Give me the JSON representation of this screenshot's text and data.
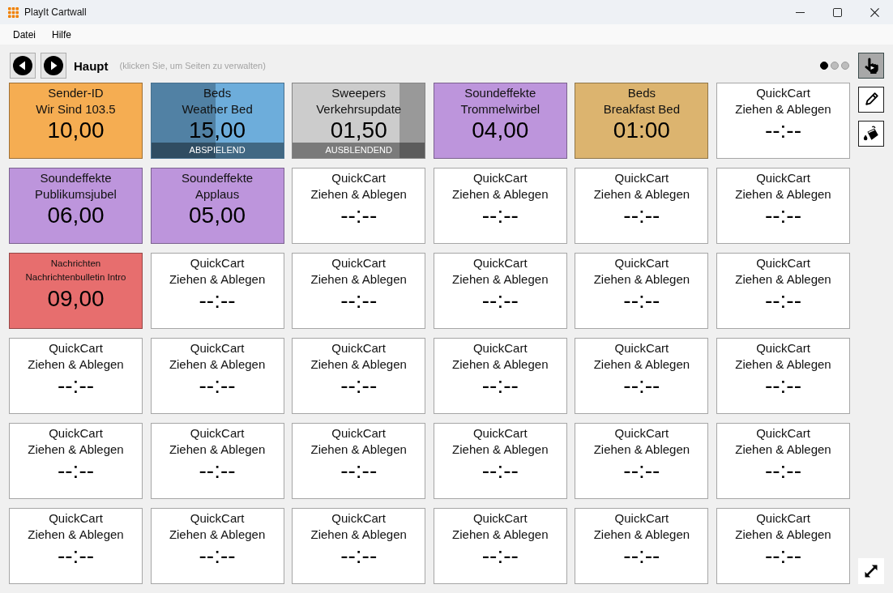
{
  "window": {
    "title": "PlayIt Cartwall"
  },
  "menu": [
    "Datei",
    "Hilfe"
  ],
  "page_nav": {
    "page_name": "Haupt",
    "hint": "(klicken Sie, um Seiten zu verwalten)",
    "pages": [
      {
        "selected": true
      },
      {
        "selected": false
      },
      {
        "selected": false
      }
    ]
  },
  "tools": [
    {
      "kind": "interact",
      "selected": true
    },
    {
      "kind": "edit",
      "selected": false
    },
    {
      "kind": "paint",
      "selected": false
    }
  ],
  "carts": [
    {
      "category": "Sender-ID",
      "title": "Wir Sind 103.5",
      "time": "10,00",
      "color": "#f5ad52"
    },
    {
      "category": "Beds",
      "title": "Weather Bed",
      "time": "15,00",
      "color": "#6daddb",
      "status": {
        "kind": "playing",
        "label": "ABSPIELEND",
        "level": 0.49
      }
    },
    {
      "category": "Sweepers",
      "title": "Verkehrsupdate",
      "time": "01,50",
      "color": "#cccccc",
      "status": {
        "kind": "fading",
        "label": "AUSBLENDEND",
        "level": 0.19
      }
    },
    {
      "category": "Soundeffekte",
      "title": "Trommelwirbel",
      "time": "04,00",
      "color": "#bd95dc"
    },
    {
      "category": "Beds",
      "title": "Breakfast Bed",
      "time": "01:00",
      "color": "#dcb46f"
    },
    {
      "category": "QuickCart",
      "title": "Ziehen & Ablegen",
      "time": "--:--",
      "color": "#ffffff"
    },
    {
      "category": "Soundeffekte",
      "title": "Publikumsjubel",
      "time": "06,00",
      "color": "#bd95dc"
    },
    {
      "category": "Soundeffekte",
      "title": "Applaus",
      "time": "05,00",
      "color": "#bd95dc"
    },
    {
      "category": "QuickCart",
      "title": "Ziehen & Ablegen",
      "time": "--:--",
      "color": "#ffffff"
    },
    {
      "category": "QuickCart",
      "title": "Ziehen & Ablegen",
      "time": "--:--",
      "color": "#ffffff"
    },
    {
      "category": "QuickCart",
      "title": "Ziehen & Ablegen",
      "time": "--:--",
      "color": "#ffffff"
    },
    {
      "category": "QuickCart",
      "title": "Ziehen & Ablegen",
      "time": "--:--",
      "color": "#ffffff"
    },
    {
      "category": "Nachrichten",
      "title": "Nachrichtenbulletin Intro",
      "time": "09,00",
      "color": "#e76e6e"
    },
    {
      "category": "QuickCart",
      "title": "Ziehen & Ablegen",
      "time": "--:--",
      "color": "#ffffff"
    },
    {
      "category": "QuickCart",
      "title": "Ziehen & Ablegen",
      "time": "--:--",
      "color": "#ffffff"
    },
    {
      "category": "QuickCart",
      "title": "Ziehen & Ablegen",
      "time": "--:--",
      "color": "#ffffff"
    },
    {
      "category": "QuickCart",
      "title": "Ziehen & Ablegen",
      "time": "--:--",
      "color": "#ffffff"
    },
    {
      "category": "QuickCart",
      "title": "Ziehen & Ablegen",
      "time": "--:--",
      "color": "#ffffff"
    },
    {
      "category": "QuickCart",
      "title": "Ziehen & Ablegen",
      "time": "--:--",
      "color": "#ffffff"
    },
    {
      "category": "QuickCart",
      "title": "Ziehen & Ablegen",
      "time": "--:--",
      "color": "#ffffff"
    },
    {
      "category": "QuickCart",
      "title": "Ziehen & Ablegen",
      "time": "--:--",
      "color": "#ffffff"
    },
    {
      "category": "QuickCart",
      "title": "Ziehen & Ablegen",
      "time": "--:--",
      "color": "#ffffff"
    },
    {
      "category": "QuickCart",
      "title": "Ziehen & Ablegen",
      "time": "--:--",
      "color": "#ffffff"
    },
    {
      "category": "QuickCart",
      "title": "Ziehen & Ablegen",
      "time": "--:--",
      "color": "#ffffff"
    },
    {
      "category": "QuickCart",
      "title": "Ziehen & Ablegen",
      "time": "--:--",
      "color": "#ffffff"
    },
    {
      "category": "QuickCart",
      "title": "Ziehen & Ablegen",
      "time": "--:--",
      "color": "#ffffff"
    },
    {
      "category": "QuickCart",
      "title": "Ziehen & Ablegen",
      "time": "--:--",
      "color": "#ffffff"
    },
    {
      "category": "QuickCart",
      "title": "Ziehen & Ablegen",
      "time": "--:--",
      "color": "#ffffff"
    },
    {
      "category": "QuickCart",
      "title": "Ziehen & Ablegen",
      "time": "--:--",
      "color": "#ffffff"
    },
    {
      "category": "QuickCart",
      "title": "Ziehen & Ablegen",
      "time": "--:--",
      "color": "#ffffff"
    },
    {
      "category": "QuickCart",
      "title": "Ziehen & Ablegen",
      "time": "--:--",
      "color": "#ffffff"
    },
    {
      "category": "QuickCart",
      "title": "Ziehen & Ablegen",
      "time": "--:--",
      "color": "#ffffff"
    },
    {
      "category": "QuickCart",
      "title": "Ziehen & Ablegen",
      "time": "--:--",
      "color": "#ffffff"
    },
    {
      "category": "QuickCart",
      "title": "Ziehen & Ablegen",
      "time": "--:--",
      "color": "#ffffff"
    },
    {
      "category": "QuickCart",
      "title": "Ziehen & Ablegen",
      "time": "--:--",
      "color": "#ffffff"
    },
    {
      "category": "QuickCart",
      "title": "Ziehen & Ablegen",
      "time": "--:--",
      "color": "#ffffff"
    }
  ]
}
